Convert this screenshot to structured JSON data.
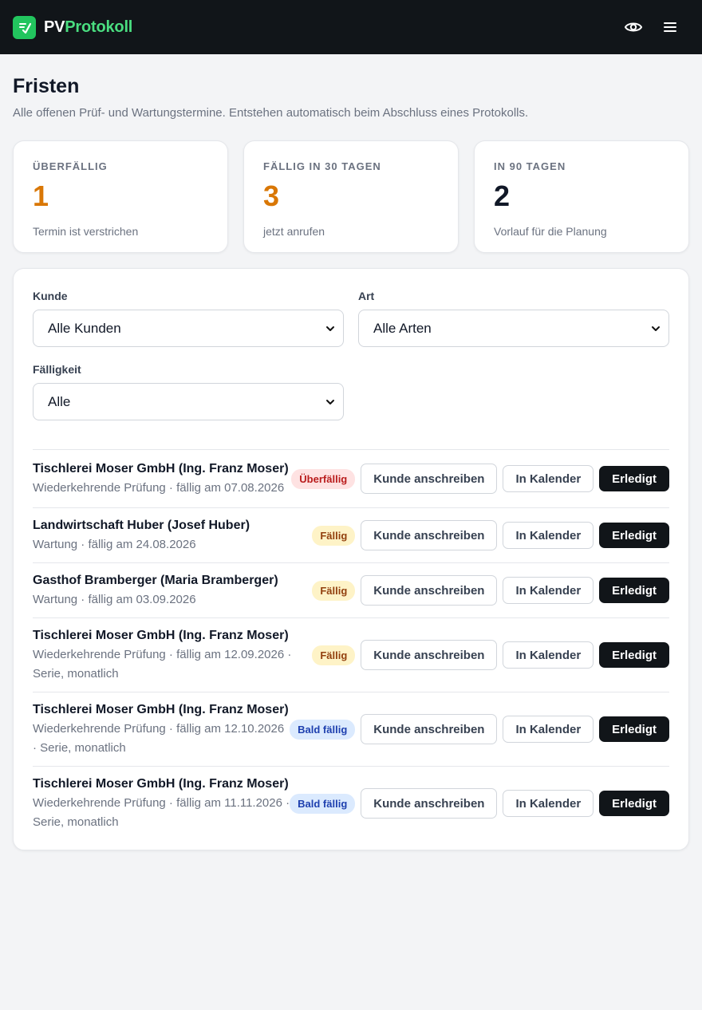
{
  "brand": {
    "part1": "PV",
    "part2": "Protokoll"
  },
  "header": {
    "icons": [
      "eye-icon",
      "menu-icon"
    ]
  },
  "page": {
    "title": "Fristen",
    "subtitle": "Alle offenen Prüf- und Wartungstermine. Entstehen automatisch beim Abschluss eines Protokolls."
  },
  "stats": [
    {
      "label": "Überfällig",
      "value": "1",
      "hint": "Termin ist verstrichen",
      "color": "#d97706"
    },
    {
      "label": "Fällig in 30 Tagen",
      "value": "3",
      "hint": "jetzt anrufen",
      "color": "#d97706"
    },
    {
      "label": "In 90 Tagen",
      "value": "2",
      "hint": "Vorlauf für die Planung",
      "color": "#111827"
    }
  ],
  "filters": {
    "kunde": {
      "label": "Kunde",
      "value": "Alle Kunden"
    },
    "art": {
      "label": "Art",
      "value": "Alle Arten"
    },
    "faelligkeit": {
      "label": "Fälligkeit",
      "value": "Alle"
    }
  },
  "actions": {
    "write": "Kunde anschreiben",
    "calendar": "In Kalender",
    "done": "Erledigt"
  },
  "rows": [
    {
      "title": "Tischlerei Moser GmbH (Ing. Franz Moser)",
      "meta": "Wiederkehrende Prüfung · fällig am 07.08.2026",
      "badge": "Überfällig",
      "status": "over"
    },
    {
      "title": "Landwirtschaft Huber (Josef Huber)",
      "meta": "Wartung · fällig am 24.08.2026",
      "badge": "Fällig",
      "status": "due"
    },
    {
      "title": "Gasthof Bramberger (Maria Bramberger)",
      "meta": "Wartung · fällig am 03.09.2026",
      "badge": "Fällig",
      "status": "due"
    },
    {
      "title": "Tischlerei Moser GmbH (Ing. Franz Moser)",
      "meta": "Wiederkehrende Prüfung · fällig am 12.09.2026 · Serie, monatlich",
      "badge": "Fällig",
      "status": "due"
    },
    {
      "title": "Tischlerei Moser GmbH (Ing. Franz Moser)",
      "meta": "Wiederkehrende Prüfung · fällig am 12.10.2026 · Serie, monatlich",
      "badge": "Bald fällig",
      "status": "soon"
    },
    {
      "title": "Tischlerei Moser GmbH (Ing. Franz Moser)",
      "meta": "Wiederkehrende Prüfung · fällig am 11.11.2026 · Serie, monatlich",
      "badge": "Bald fällig",
      "status": "soon"
    }
  ]
}
